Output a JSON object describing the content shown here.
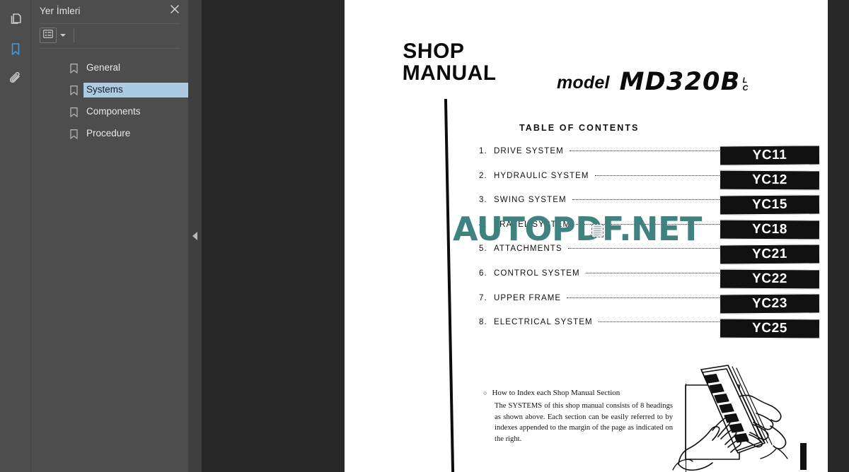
{
  "rail": {
    "items": [
      {
        "name": "pages-thumbnails",
        "icon": "pages-icon",
        "active": false
      },
      {
        "name": "bookmarks",
        "icon": "bookmark-icon",
        "active": true
      },
      {
        "name": "attachments",
        "icon": "paperclip-icon",
        "active": false
      }
    ]
  },
  "panel": {
    "title": "Yer İmleri",
    "close_icon": "close-icon",
    "toolbar": {
      "options_icon": "list-options-icon",
      "caret_icon": "chevron-down-icon"
    },
    "bookmarks": [
      {
        "label": "General",
        "selected": false
      },
      {
        "label": "Systems",
        "selected": true
      },
      {
        "label": "Components",
        "selected": false
      },
      {
        "label": "Procedure",
        "selected": false
      }
    ]
  },
  "collapse": {
    "icon": "collapse-left-icon"
  },
  "watermark": {
    "text": "AUTOPDF.NET",
    "color": "#3f8280"
  },
  "document": {
    "shop_title_line1": "SHOP",
    "shop_title_line2": "MANUAL",
    "model_word": "model",
    "model_code": "MD320B",
    "model_sub_top": "L",
    "model_sub_bottom": "C",
    "toc_heading": "TABLE OF CONTENTS",
    "toc": [
      {
        "num": "1.",
        "name": "DRIVE SYSTEM"
      },
      {
        "num": "2.",
        "name": "HYDRAULIC SYSTEM"
      },
      {
        "num": "3.",
        "name": "SWING SYSTEM"
      },
      {
        "num": "4.",
        "name": "TRAVEL SYSTEM"
      },
      {
        "num": "5.",
        "name": "ATTACHMENTS"
      },
      {
        "num": "6.",
        "name": "CONTROL SYSTEM"
      },
      {
        "num": "7.",
        "name": "UPPER FRAME"
      },
      {
        "num": "8.",
        "name": "ELECTRICAL SYSTEM"
      }
    ],
    "index_tabs": [
      "YC11",
      "YC12",
      "YC15",
      "YC18",
      "YC21",
      "YC22",
      "YC23",
      "YC25"
    ],
    "note_bullet": "○",
    "note_heading": "How to Index each Shop Manual Section",
    "note_body": "The SYSTEMS of this shop manual consists of 8 headings as shown above. Each section can be easily referred to by indexes appended to the margin of the page as indicated on the right."
  }
}
